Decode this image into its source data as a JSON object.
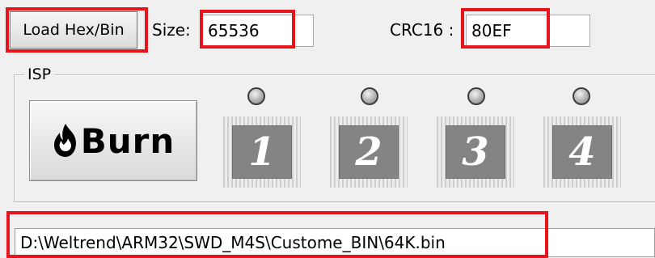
{
  "toolbar": {
    "load_label": "Load Hex/Bin",
    "size_label": "Size:",
    "size_value": "65536",
    "crc_label": "CRC16 :",
    "crc_value": "80EF"
  },
  "isp": {
    "group_label": "ISP",
    "burn_label": "Burn",
    "burn_icon": "flame-icon",
    "led_icon": "status-led",
    "sockets": [
      {
        "label": "1"
      },
      {
        "label": "2"
      },
      {
        "label": "3"
      },
      {
        "label": "4"
      }
    ]
  },
  "file": {
    "path": "D:\\Weltrend\\ARM32\\SWD_M4S\\Custome_BIN\\64K.bin"
  },
  "colors": {
    "highlight": "#e8141c",
    "window_bg": "#f0f0f0",
    "chip_fill": "#848484"
  }
}
